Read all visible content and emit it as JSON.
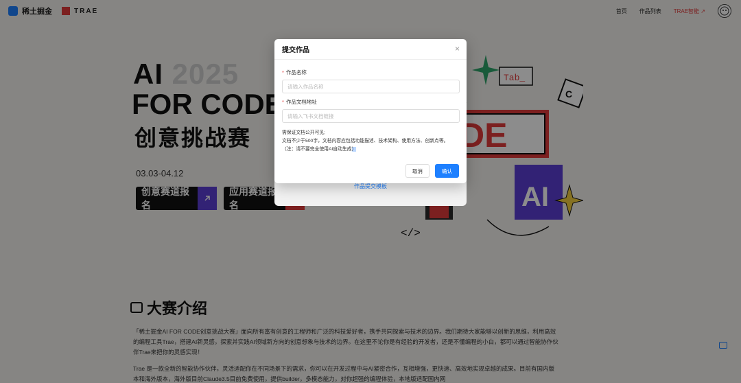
{
  "header": {
    "brand_name": "稀土掘金",
    "partner_name": "TRAE",
    "nav": [
      "首页",
      "作品列表",
      "TRAE智能"
    ],
    "nav_accent_arrow": "↗"
  },
  "hero": {
    "title_ai": "AI",
    "title_year": "2025",
    "title_line2": "FOR CODE",
    "title_line3": "创意挑战赛",
    "date_range": "03.03-04.12",
    "btn_creative": "创意赛道报名",
    "btn_app": "应用赛道报名"
  },
  "art": {
    "tab_label": "Tab_",
    "code_text": "DE",
    "ai_text": "AI",
    "slash_tag": "</>"
  },
  "intro": {
    "title": "大赛介绍",
    "p1": "「稀土掘金AI FOR CODE创意挑战大赛」面向所有富有创意的工程师和广泛的科技爱好者，携手共同探索与技术的边界。我们期待大家能够以创新的思维，利用高效的编程工具Trae，搭建AI新灵感，探索并实践AI领域新方向的创意想象与技术的边界。在这里不论你是有经验的开发者，还是不懂编程的小白，都可以通过智能协作伙伴Trae来把你的灵感实现！",
    "p2": "Trae 是一款全新的智能协作伙伴，灵活适配你在不同场景下的需求，你可以在开发过程中与AI紧密合作，互相增强，更快速、高效地实现卓越的成果。目前有国内版本和海外版本，海外版目前Claude3.5目前免费使用，提供builder，多模态能力，对你超强的编程体验，本地版适配国内网"
  },
  "under_panel": {
    "link": "作品提交模板"
  },
  "modal": {
    "title": "提交作品",
    "close": "×",
    "name_label": "作品名称",
    "name_placeholder": "请输入作品名称",
    "url_label": "作品文档地址",
    "url_placeholder": "请输入飞书文档链接",
    "note_line1": "需保证文档公开可见;",
    "note_line2": "文档不少于500字，文档内容应包括功能描述、技术架构、使用方法、创新点等。",
    "note_line3_main": "（注：请不要完全使用AI自动生成",
    "note_line3_hl": "）",
    "cancel": "取消",
    "confirm": "确认"
  },
  "colors": {
    "primary": "#1e80ff",
    "accent_red": "#e23b3b",
    "accent_purple": "#5b3fd6"
  }
}
